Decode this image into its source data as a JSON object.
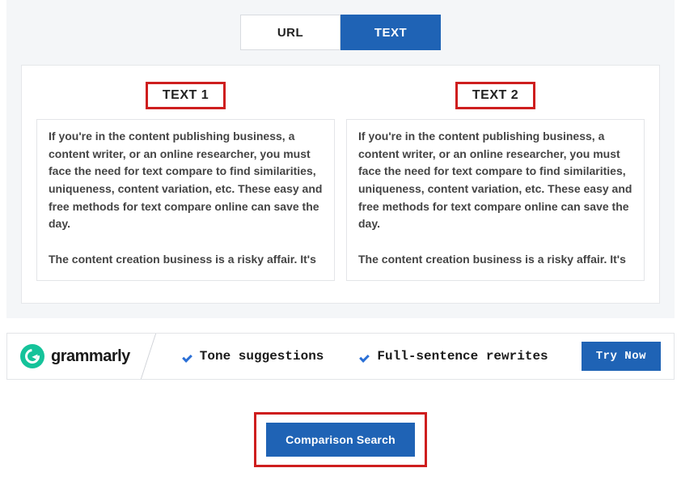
{
  "tabs": {
    "url_label": "URL",
    "text_label": "TEXT"
  },
  "columns": {
    "text1_header": "TEXT 1",
    "text2_header": "TEXT 2",
    "text1_content": "If you're in the content publishing business, a content writer, or an online researcher, you must face the need for text compare to find similarities, uniqueness, content variation, etc. These easy and free methods for text compare online can save the day.\n\nThe content creation business is a risky affair. It's           ",
    "text2_content": "If you're in the content publishing business, a content writer, or an online researcher, you must face the need for text compare to find similarities, uniqueness, content variation, etc. These easy and free methods for text compare online can save the day.\n\nThe content creation business is a risky affair. It's           "
  },
  "ad": {
    "brand": "grammarly",
    "feature1": "Tone suggestions",
    "feature2": "Full-sentence rewrites",
    "cta": "Try Now"
  },
  "action": {
    "compare_label": "Comparison Search"
  }
}
